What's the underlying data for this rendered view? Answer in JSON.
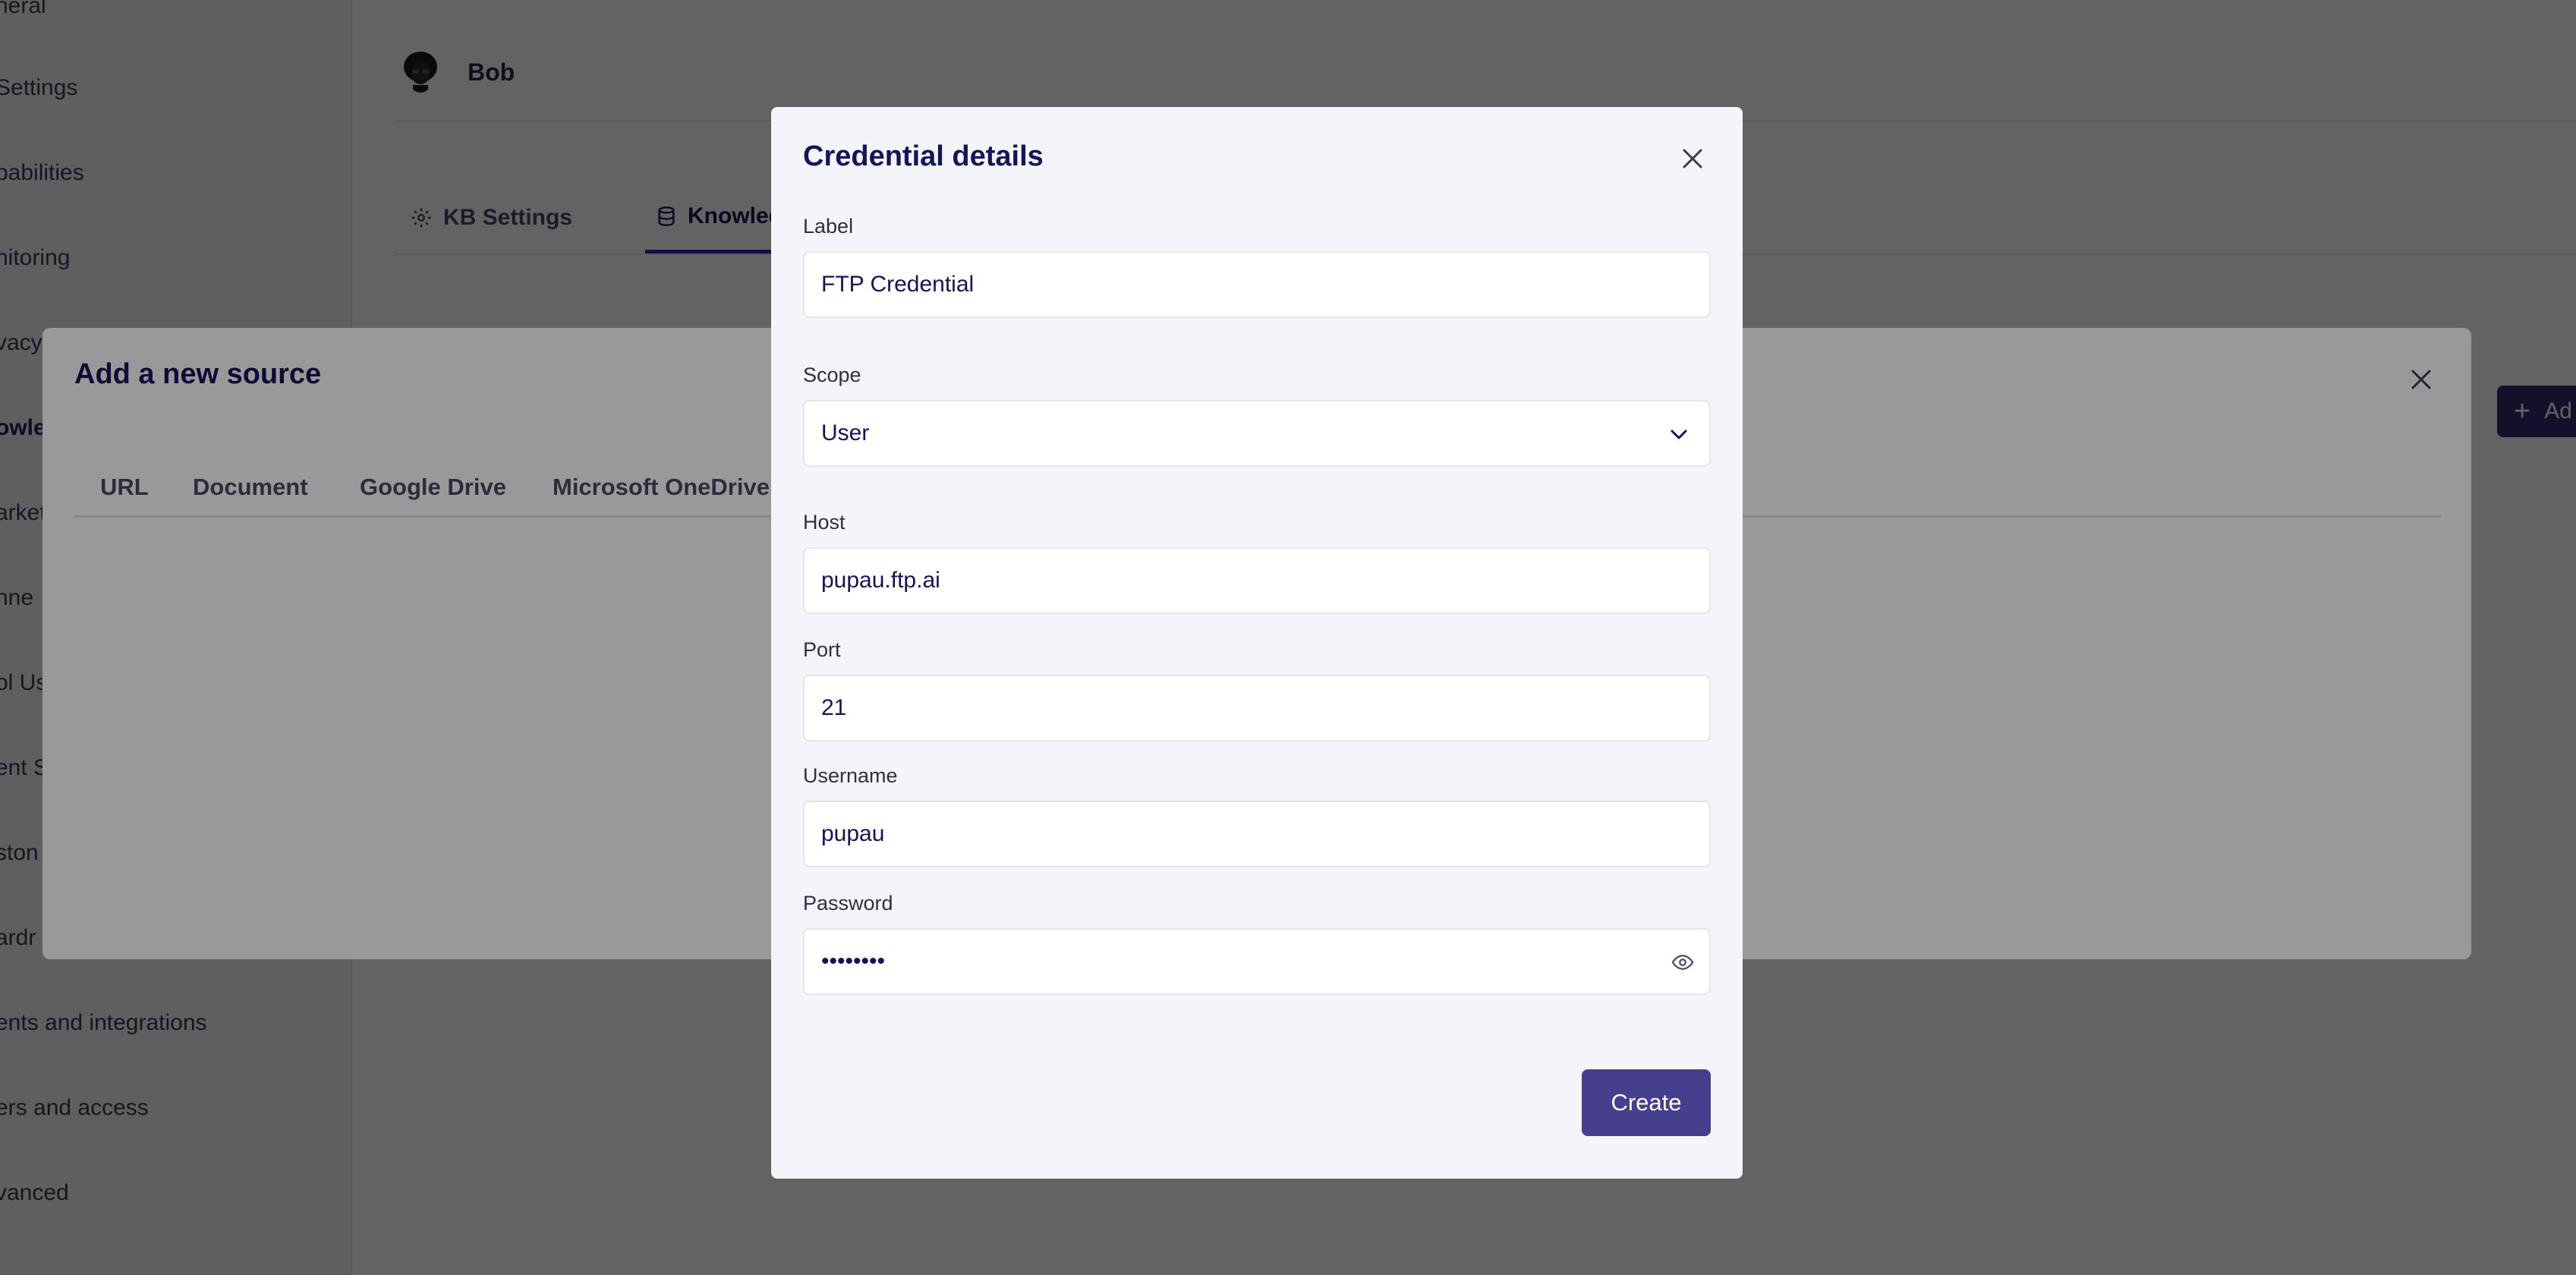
{
  "sidebar": {
    "items": [
      {
        "label": "neral",
        "active": false
      },
      {
        "label": "Settings",
        "active": false
      },
      {
        "label": "pabilities",
        "active": false
      },
      {
        "label": "nitoring",
        "active": false
      },
      {
        "label": "vacy",
        "active": false
      },
      {
        "label": "owle",
        "active": true
      },
      {
        "label": "arket",
        "active": false
      },
      {
        "label": "nne",
        "active": false
      },
      {
        "label": "ol Us",
        "active": false
      },
      {
        "label": "ent S",
        "active": false
      },
      {
        "label": "ston",
        "active": false
      },
      {
        "label": "ardr",
        "active": false
      },
      {
        "label": "ents and integrations",
        "active": false
      },
      {
        "label": "ers and access",
        "active": false
      },
      {
        "label": "vanced",
        "active": false
      }
    ]
  },
  "agent": {
    "name": "Bob"
  },
  "kb_tabs": [
    {
      "label": "KB Settings",
      "icon": "gear-icon"
    },
    {
      "label": "Knowledg",
      "icon": "database-icon",
      "active": true
    }
  ],
  "add_button": {
    "label": "Ad"
  },
  "source_modal": {
    "title": "Add a new source",
    "tabs": [
      "URL",
      "Document",
      "Google Drive",
      "Microsoft OneDrive"
    ]
  },
  "credential_modal": {
    "title": "Credential details",
    "fields": {
      "label": {
        "label": "Label",
        "value": "FTP Credential"
      },
      "scope": {
        "label": "Scope",
        "value": "User"
      },
      "host": {
        "label": "Host",
        "value": "pupau.ftp.ai"
      },
      "port": {
        "label": "Port",
        "value": "21"
      },
      "username": {
        "label": "Username",
        "value": "pupau"
      },
      "password": {
        "label": "Password",
        "value": "••••••••"
      }
    },
    "create_label": "Create"
  },
  "colors": {
    "accent": "#463f8e",
    "title": "#14145a",
    "modal_bg": "#f4f5fb"
  }
}
